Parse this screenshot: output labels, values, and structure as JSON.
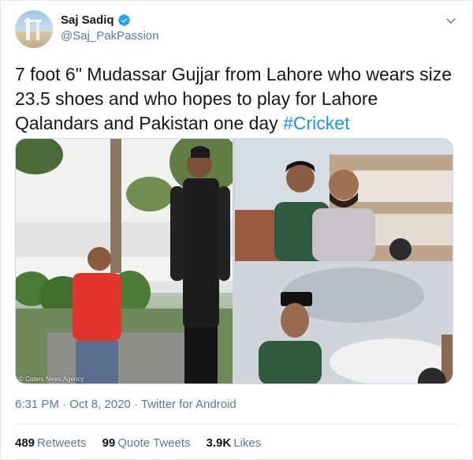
{
  "author": {
    "display_name": "Saj Sadiq",
    "handle": "@Saj_PakPassion",
    "verified": true
  },
  "tweet": {
    "text": "7 foot 6\" Mudassar Gujjar from Lahore who wears size 23.5 shoes and who hopes to play for Lahore Qalandars and Pakistan one day ",
    "hashtag": "#Cricket"
  },
  "media": {
    "caption": "© Caters News Agency",
    "images": [
      {
        "name": "tall-man-with-friend-garden-photo"
      },
      {
        "name": "two-men-posing-photo"
      },
      {
        "name": "young-man-cap-sky-photo"
      }
    ]
  },
  "meta": {
    "time": "6:31 PM",
    "separator": "·",
    "date": "Oct 8, 2020",
    "source": "Twitter for Android"
  },
  "stats": {
    "retweets_count": "489",
    "retweets_label": "Retweets",
    "quote_count": "99",
    "quote_label": "Quote Tweets",
    "likes_count": "3.9K",
    "likes_label": "Likes"
  },
  "colors": {
    "link": "#1b95e0",
    "secondary_text": "#657786",
    "primary_text": "#14171a",
    "verified_badge": "#1da1f2"
  },
  "icons": {
    "verified": "verified-badge-icon",
    "menu": "chevron-down-icon"
  }
}
